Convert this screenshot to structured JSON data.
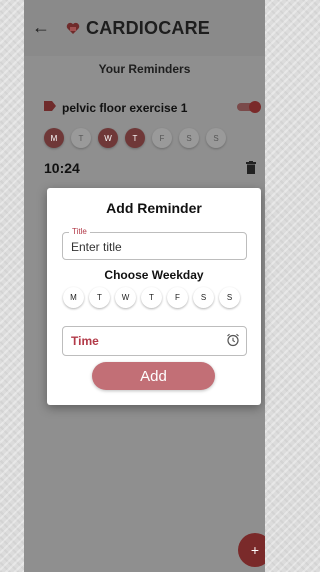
{
  "appbar": {
    "title": "CARDIOCARE",
    "back_icon": "arrow-left-icon",
    "logo_icon": "heart-logo-icon"
  },
  "page": {
    "subtitle": "Your Reminders"
  },
  "reminder": {
    "title": "pelvic floor exercise 1",
    "time": "10:24",
    "enabled": true,
    "days": [
      {
        "label": "M",
        "selected": true
      },
      {
        "label": "T",
        "selected": false
      },
      {
        "label": "W",
        "selected": true
      },
      {
        "label": "T",
        "selected": true
      },
      {
        "label": "F",
        "selected": false
      },
      {
        "label": "S",
        "selected": false
      },
      {
        "label": "S",
        "selected": false
      }
    ]
  },
  "dialog": {
    "title": "Add Reminder",
    "title_field": {
      "label": "Title",
      "placeholder": "Enter title"
    },
    "weekday_label": "Choose Weekday",
    "weekdays": [
      "M",
      "T",
      "W",
      "T",
      "F",
      "S",
      "S"
    ],
    "time_label": "Time",
    "add_label": "Add"
  },
  "fab": {
    "label": "+"
  },
  "colors": {
    "accent": "#c26f76",
    "accent_dark": "#7a2a2a",
    "label_red": "#b23a48"
  }
}
